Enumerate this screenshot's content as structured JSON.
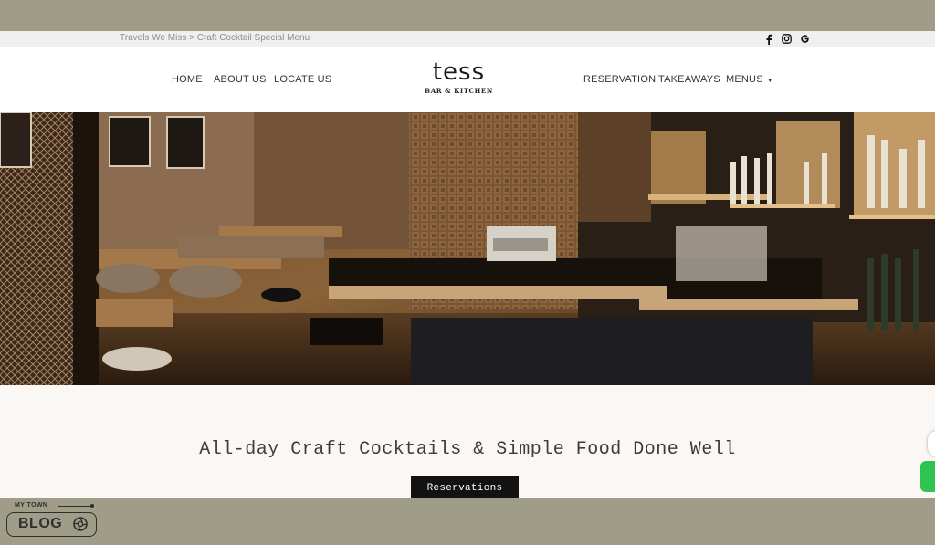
{
  "breadcrumb": {
    "parent": "Travels We Miss",
    "separator": ">",
    "current": "Craft Cocktail Special Menu"
  },
  "social": [
    {
      "icon": "facebook-icon"
    },
    {
      "icon": "instagram-icon"
    },
    {
      "icon": "google-icon"
    }
  ],
  "nav_left": [
    "HOME",
    "ABOUT US",
    "LOCATE US"
  ],
  "nav_right": [
    "RESERVATION",
    "TAKEAWAYS",
    "MENUS"
  ],
  "menus_caret": "▼",
  "logo": {
    "word": "tess",
    "subtitle": "BAR & KITCHEN"
  },
  "hero": {
    "image": "restaurant-bar-interior-photo"
  },
  "tagline": "All-day Craft Cocktails & Simple Food Done Well",
  "reservation_button": "Reservations",
  "badge": {
    "top": "MY TOWN",
    "main": "BLOG"
  },
  "colors": {
    "outer_bg": "#9f9d88",
    "page_bg": "#fbf7f4",
    "button_bg": "#121212",
    "whatsapp": "#2fc352"
  }
}
